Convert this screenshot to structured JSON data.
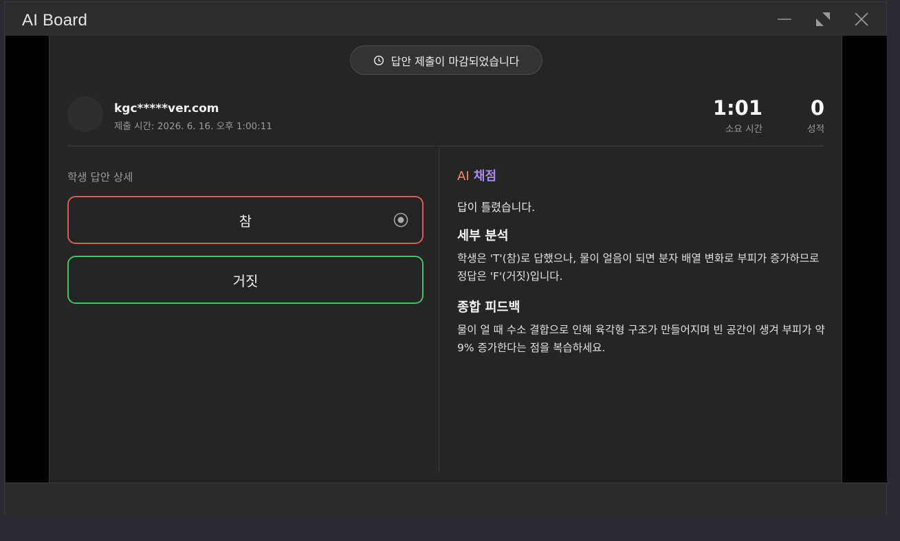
{
  "window": {
    "title": "AI Board",
    "controls": [
      "minimize-icon",
      "maximize-icon",
      "close-icon"
    ]
  },
  "banner": {
    "text": "답안 제출이 마감되었습니다",
    "icon": "clock-icon"
  },
  "student": {
    "email": "kgc*****ver.com",
    "submitted": "제출 시간: 2026. 6. 16. 오후 1:00:11"
  },
  "stats": {
    "time_value": "1:01",
    "time_label": "소요 시간",
    "score_value": "0",
    "score_label": "성적"
  },
  "answer": {
    "heading": "학생 답안 상세",
    "options": [
      {
        "label": "참",
        "selected": true,
        "status": "wrong",
        "border_color": "#e05a5a"
      },
      {
        "label": "거짓",
        "selected": false,
        "status": "correct",
        "border_color": "#3ec46a"
      }
    ]
  },
  "ai": {
    "prefix": "AI",
    "title": "채점",
    "result": "답이 틀렸습니다.",
    "analysis_heading": "세부 분석",
    "analysis_body": "학생은 'T'(참)로 답했으나, 물이 얼음이 되면 분자 배열 변화로 부피가 증가하므로 정답은 'F'(거짓)입니다.",
    "feedback_heading": "종합 피드백",
    "feedback_body": "물이 얼 때 수소 결합으로 인해 육각형 구조가 만들어지며 빈 공간이 생겨 부피가 약 9% 증가한다는 점을 복습하세요."
  },
  "colors": {
    "wrong": "#e05a5a",
    "correct": "#3ec46a",
    "ai_prefix": "#ef8d6f",
    "ai_title": "#a98cf0"
  }
}
